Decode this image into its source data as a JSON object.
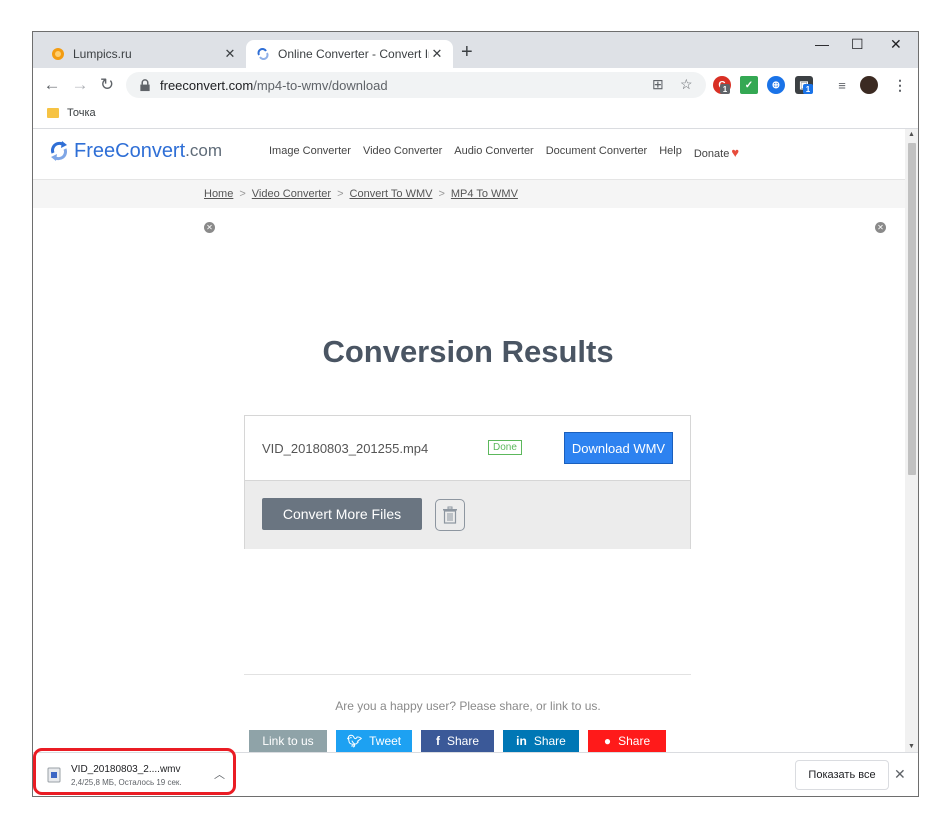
{
  "browser": {
    "tabs": [
      {
        "title": "Lumpics.ru",
        "active": false
      },
      {
        "title": "Online Converter - Convert Imag",
        "active": true
      }
    ],
    "new_tab": "+",
    "window_controls": {
      "minimize": "—",
      "maximize": "☐",
      "close": "✕"
    },
    "url_domain": "freeconvert.com",
    "url_path": "/mp4-to-wmv/download",
    "bookmark": "Точка",
    "extension_badges": [
      "1",
      "1"
    ]
  },
  "site": {
    "logo_word": "FreeConvert",
    "logo_suffix": ".com",
    "nav": [
      "Image Converter",
      "Video Converter",
      "Audio Converter",
      "Document Converter",
      "Help",
      "Donate"
    ],
    "breadcrumbs": [
      "Home",
      "Video Converter",
      "Convert To WMV",
      "MP4 To WMV"
    ],
    "breadcrumb_separator": ">",
    "title": "Conversion Results",
    "file": {
      "name": "VID_20180803_201255.mp4",
      "status": "Done",
      "download_label": "Download WMV"
    },
    "convert_more_label": "Convert More Files",
    "share_text": "Are you a happy user? Please share, or link to us.",
    "share_buttons": [
      {
        "label": "Link to us",
        "icon": "",
        "color": "#8fa3a8"
      },
      {
        "label": "Tweet",
        "icon": "twitter-icon",
        "color": "#1da1f2"
      },
      {
        "label": "Share",
        "icon": "facebook-icon",
        "color": "#3b5998"
      },
      {
        "label": "Share",
        "icon": "linkedin-icon",
        "color": "#0077b5"
      },
      {
        "label": "Share",
        "icon": "reddit-icon",
        "color": "#ff1a1a"
      }
    ]
  },
  "download": {
    "file_name": "VID_20180803_2....wmv",
    "status": "2,4/25,8 МБ, Осталось 19 сек.",
    "show_all_label": "Показать все",
    "close": "✕"
  },
  "colors": {
    "accent_blue": "#2d82f0",
    "heading": "#4a5563",
    "highlight": "#ea1c24"
  }
}
